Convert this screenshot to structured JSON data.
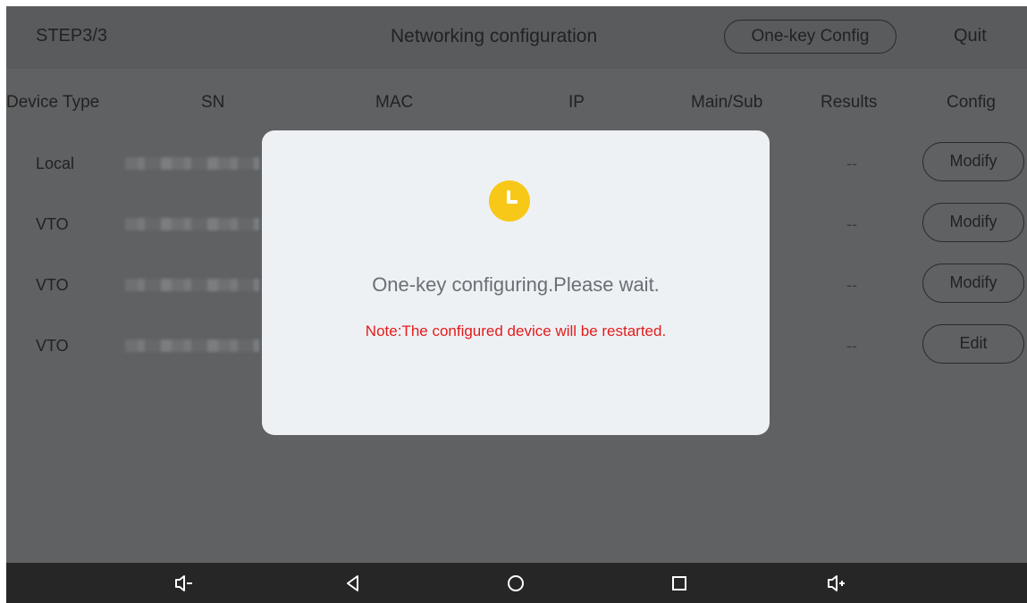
{
  "header": {
    "step": "STEP3/3",
    "title": "Networking configuration",
    "onekey_label": "One-key Config",
    "quit_label": "Quit"
  },
  "table": {
    "columns": [
      "Device Type",
      "SN",
      "MAC",
      "IP",
      "Main/Sub",
      "Results",
      "Config"
    ],
    "rows": [
      {
        "type": "Local",
        "result": "--",
        "action": "Modify"
      },
      {
        "type": "VTO",
        "result": "--",
        "action": "Modify"
      },
      {
        "type": "VTO",
        "result": "--",
        "action": "Modify"
      },
      {
        "type": "VTO",
        "result": "--",
        "action": "Edit"
      }
    ]
  },
  "dialog": {
    "icon": "clock-icon",
    "message": "One-key configuring.Please wait.",
    "note": "Note:The configured device will be restarted."
  },
  "navbar": {
    "icons": [
      "volume-down-icon",
      "back-icon",
      "home-icon",
      "recents-icon",
      "volume-up-icon"
    ]
  },
  "colors": {
    "accent": "#f7c817",
    "note": "#e31c1c",
    "overlay": "#5f6163",
    "navbar": "#262626"
  }
}
